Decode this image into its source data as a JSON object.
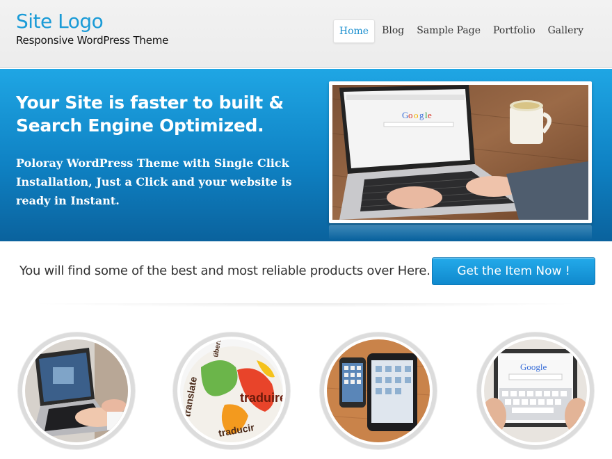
{
  "header": {
    "site_title": "Site Logo",
    "tagline": "Responsive WordPress Theme",
    "nav": [
      {
        "label": "Home",
        "active": true
      },
      {
        "label": "Blog",
        "active": false
      },
      {
        "label": "Sample Page",
        "active": false
      },
      {
        "label": "Portfolio",
        "active": false
      },
      {
        "label": "Gallery",
        "active": false
      }
    ]
  },
  "hero": {
    "heading": "Your Site is faster to built & Search Engine Optimized.",
    "text": "Poloray WordPress Theme with Single Click Installation, Just a Click and your website is ready in Instant.",
    "image_screen_text": "Google"
  },
  "cta": {
    "text": "You will find some of the best and most reliable products over Here.",
    "button_label": "Get the Item Now !"
  },
  "features": {
    "images": [
      {
        "subject": "laptop-hands"
      },
      {
        "subject": "translate-globe",
        "words": [
          "translate",
          "übersetzen",
          "traduire",
          "traducir"
        ]
      },
      {
        "subject": "phone-and-tablet"
      },
      {
        "subject": "tablet-google",
        "screen_text": "Google"
      }
    ]
  },
  "colors": {
    "brand_blue": "#1a9bd7",
    "hero_top": "#1fa6e4",
    "hero_bottom": "#0a629d",
    "button": "#1089cd"
  }
}
